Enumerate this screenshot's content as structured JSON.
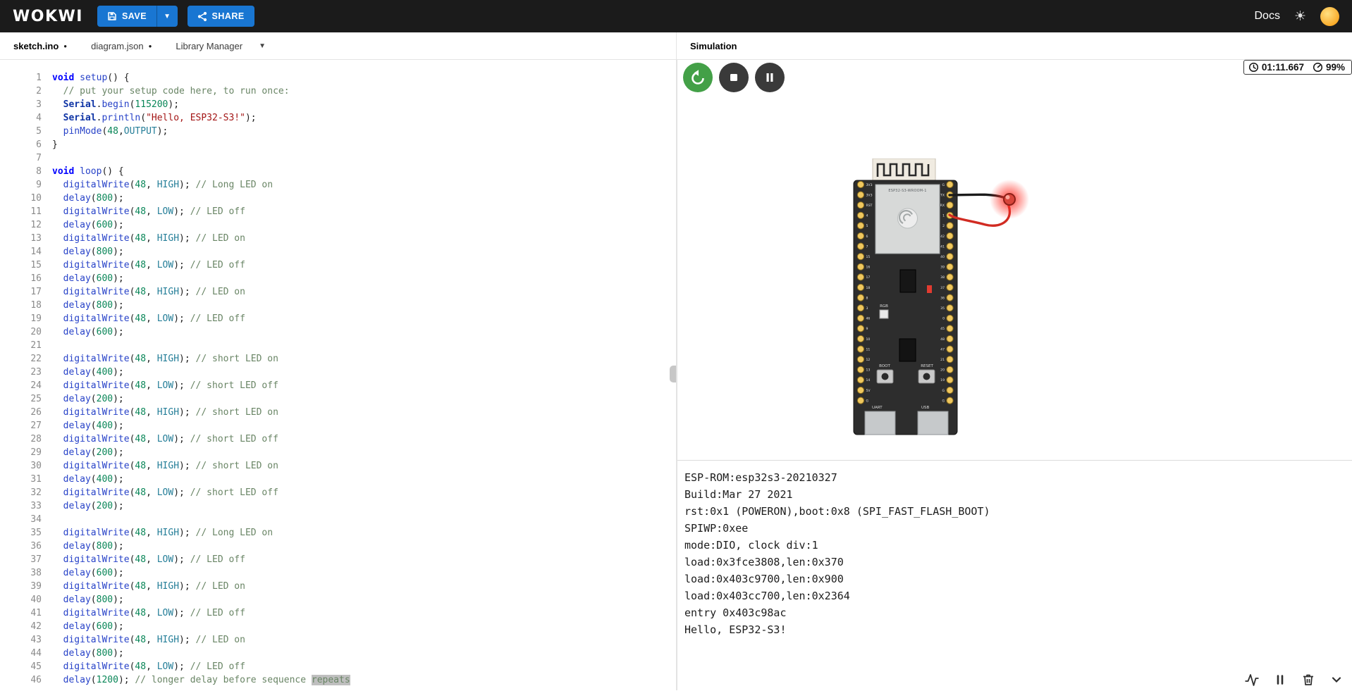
{
  "topbar": {
    "logo": "WOKWI",
    "save_label": "SAVE",
    "share_label": "SHARE",
    "docs_label": "Docs"
  },
  "tabs": [
    {
      "label": "sketch.ino",
      "dirty": true,
      "active": true
    },
    {
      "label": "diagram.json",
      "dirty": true,
      "active": false
    },
    {
      "label": "Library Manager",
      "dropdown": true,
      "active": false
    }
  ],
  "editor": {
    "lines": [
      "void setup() {",
      "  // put your setup code here, to run once:",
      "  Serial.begin(115200);",
      "  Serial.println(\"Hello, ESP32-S3!\");",
      "  pinMode(48,OUTPUT);",
      "}",
      "",
      "void loop() {",
      "  digitalWrite(48, HIGH); // Long LED on",
      "  delay(800);",
      "  digitalWrite(48, LOW); // LED off",
      "  delay(600);",
      "  digitalWrite(48, HIGH); // LED on",
      "  delay(800);",
      "  digitalWrite(48, LOW); // LED off",
      "  delay(600);",
      "  digitalWrite(48, HIGH); // LED on",
      "  delay(800);",
      "  digitalWrite(48, LOW); // LED off",
      "  delay(600);",
      "",
      "  digitalWrite(48, HIGH); // short LED on",
      "  delay(400);",
      "  digitalWrite(48, LOW); // short LED off",
      "  delay(200);",
      "  digitalWrite(48, HIGH); // short LED on",
      "  delay(400);",
      "  digitalWrite(48, LOW); // short LED off",
      "  delay(200);",
      "  digitalWrite(48, HIGH); // short LED on",
      "  delay(400);",
      "  digitalWrite(48, LOW); // short LED off",
      "  delay(200);",
      "",
      "  digitalWrite(48, HIGH); // Long LED on",
      "  delay(800);",
      "  digitalWrite(48, LOW); // LED off",
      "  delay(600);",
      "  digitalWrite(48, HIGH); // LED on",
      "  delay(800);",
      "  digitalWrite(48, LOW); // LED off",
      "  delay(600);",
      "  digitalWrite(48, HIGH); // LED on",
      "  delay(800);",
      "  digitalWrite(48, LOW); // LED off",
      "  delay(1200); // longer delay before sequence repeats"
    ],
    "selection": {
      "line": 46,
      "word": "repeats"
    }
  },
  "simulation": {
    "tab_label": "Simulation",
    "timer": "01:11.667",
    "cpu_load": "99%",
    "board": {
      "module_label": "ESP32-S3-WROOM-1",
      "rgb_label": "RGB",
      "boot_label": "BOOT",
      "reset_label": "RESET",
      "uart_label": "UART",
      "usb_label": "USB",
      "left_pins": [
        "3V3",
        "3V3",
        "RST",
        "4",
        "5",
        "6",
        "7",
        "15",
        "16",
        "17",
        "18",
        "8",
        "3",
        "46",
        "9",
        "10",
        "11",
        "12",
        "13",
        "14",
        "5V",
        "G"
      ],
      "right_pins": [
        "G",
        "TX",
        "RX",
        "1",
        "2",
        "42",
        "41",
        "40",
        "39",
        "38",
        "37",
        "36",
        "35",
        "0",
        "45",
        "48",
        "47",
        "21",
        "20",
        "19",
        "G",
        "G"
      ]
    },
    "serial_output": [
      "ESP-ROM:esp32s3-20210327",
      "Build:Mar 27 2021",
      "rst:0x1 (POWERON),boot:0x8 (SPI_FAST_FLASH_BOOT)",
      "SPIWP:0xee",
      "mode:DIO, clock div:1",
      "load:0x3fce3808,len:0x370",
      "load:0x403c9700,len:0x900",
      "load:0x403cc700,len:0x2364",
      "entry 0x403c98ac",
      "Hello, ESP32-S3!"
    ]
  },
  "colors": {
    "accent_blue": "#1976d2",
    "run_green": "#43a047",
    "led_red": "#ff2d23",
    "topbar_bg": "#1b1b1b"
  }
}
